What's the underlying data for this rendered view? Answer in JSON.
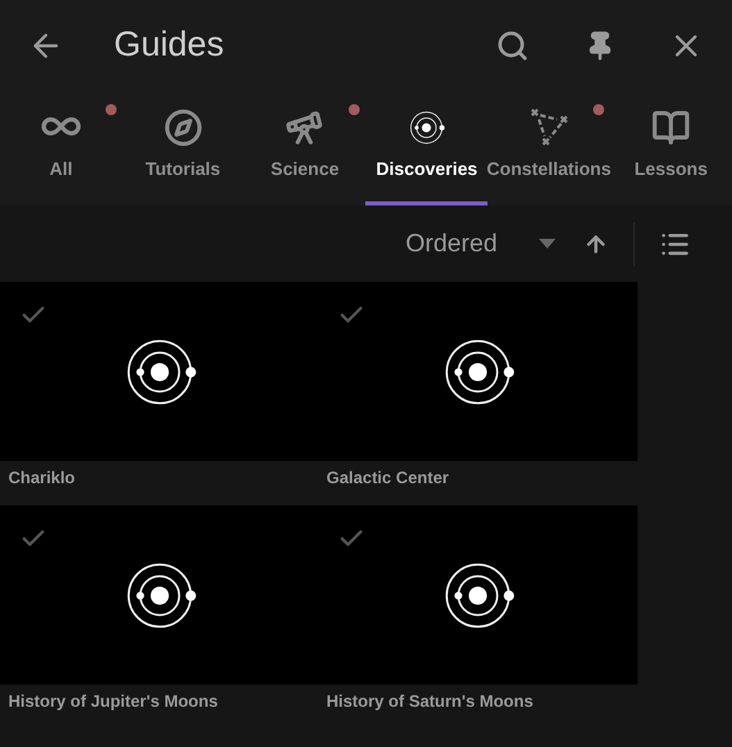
{
  "header": {
    "title": "Guides"
  },
  "tabs": [
    {
      "label": "All",
      "selected": false,
      "dot": true
    },
    {
      "label": "Tutorials",
      "selected": false,
      "dot": false
    },
    {
      "label": "Science",
      "selected": false,
      "dot": true
    },
    {
      "label": "Discoveries",
      "selected": true,
      "dot": false
    },
    {
      "label": "Constellations",
      "selected": false,
      "dot": true
    },
    {
      "label": "Lessons",
      "selected": false,
      "dot": false
    }
  ],
  "toolbar": {
    "sort": "Ordered"
  },
  "cards": [
    {
      "title": "Chariklo",
      "checked": true
    },
    {
      "title": "Galactic Center",
      "checked": true
    },
    {
      "title": "History of Jupiter's Moons",
      "checked": true
    },
    {
      "title": "History of Saturn's Moons",
      "checked": true
    }
  ]
}
